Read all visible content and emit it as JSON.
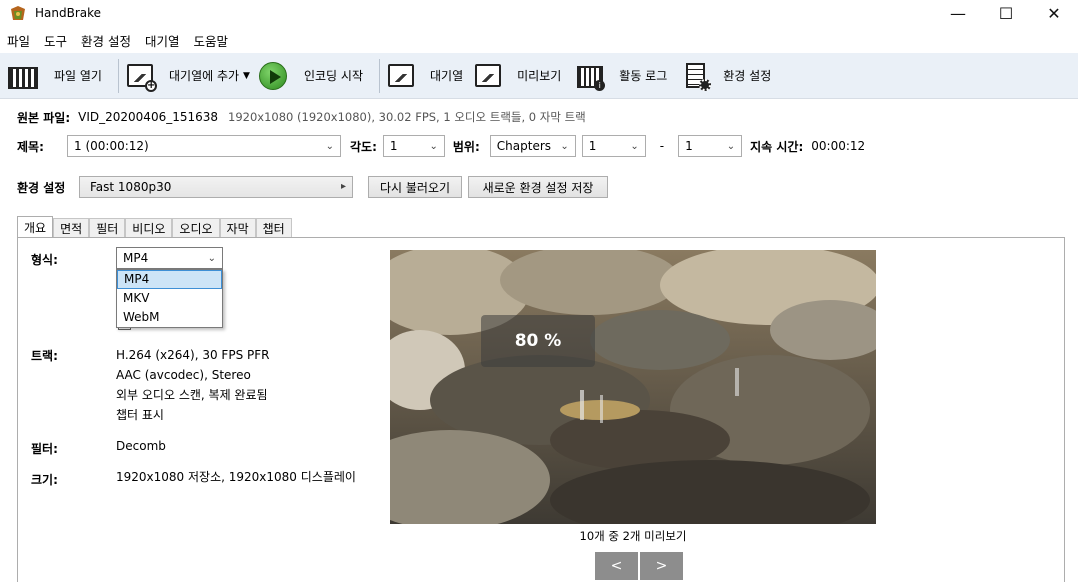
{
  "app": {
    "title": "HandBrake"
  },
  "window_controls": {
    "minimize": "—",
    "maximize": "☐",
    "close": "✕"
  },
  "menu": [
    "파일",
    "도구",
    "환경 설정",
    "대기열",
    "도움말"
  ],
  "toolbar": {
    "open_source": "파일 열기",
    "add_to_queue": "대기열에 추가",
    "start_encode": "인코딩 시작",
    "queue": "대기열",
    "preview": "미리보기",
    "activity_log": "활동 로그",
    "preferences": "환경 설정"
  },
  "source": {
    "label": "원본 파일:",
    "name": "VID_20200406_151638",
    "info": "1920x1080 (1920x1080), 30.02 FPS, 1 오디오 트랙들, 0 자막 트랙"
  },
  "title_row": {
    "title_label": "제목:",
    "title_value": "1 (00:00:12)",
    "angle_label": "각도:",
    "angle_value": "1",
    "range_label": "범위:",
    "range_type": "Chapters",
    "range_start": "1",
    "range_dash": "-",
    "range_end": "1",
    "duration_label": "지속 시간:",
    "duration_value": "00:00:12"
  },
  "preset_row": {
    "label": "환경 설정",
    "value": "Fast 1080p30",
    "reload_button": "다시 불러오기",
    "save_new_button": "새로운 환경 설정 저장"
  },
  "tabs": [
    "개요",
    "면적",
    "필터",
    "비디오",
    "오디오",
    "자막",
    "챕터"
  ],
  "summary": {
    "format_label": "형식:",
    "format_value": "MP4",
    "format_options": [
      "MP4",
      "MKV",
      "WebM"
    ],
    "tracks_label": "트랙:",
    "tracks": [
      "H.264 (x264), 30 FPS PFR",
      "AAC (avcodec), Stereo",
      "외부 오디오 스캔, 복제 완료됨",
      "챕터 표시"
    ],
    "filters_label": "필터:",
    "filters_value": "Decomb",
    "size_label": "크기:",
    "size_value": "1920x1080 저장소, 1920x1080 디스플레이"
  },
  "preview": {
    "percent": "80 %",
    "caption": "10개 중 2개 미리보기",
    "prev": "<",
    "next": ">"
  }
}
